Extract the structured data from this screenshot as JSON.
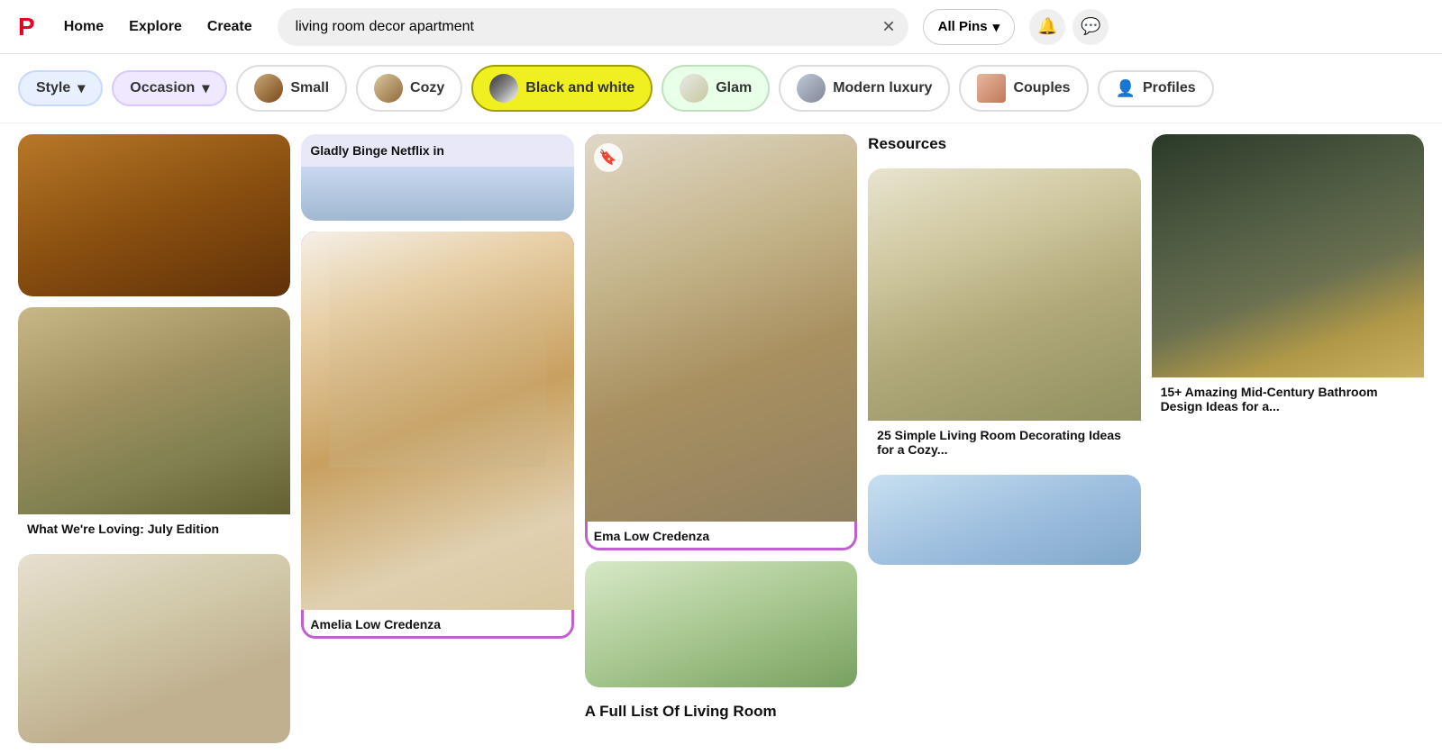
{
  "header": {
    "nav": [
      {
        "label": "Home",
        "id": "home"
      },
      {
        "label": "Explore",
        "id": "explore"
      },
      {
        "label": "Create",
        "id": "create"
      }
    ],
    "search": {
      "value": "living room decor apartment",
      "placeholder": "Search"
    },
    "allPins": "All Pins",
    "notificationIcon": "🔔",
    "messageIcon": "💬"
  },
  "filters": [
    {
      "label": "Style",
      "type": "dropdown",
      "style": "style"
    },
    {
      "label": "Occasion",
      "type": "dropdown",
      "style": "occasion"
    },
    {
      "label": "Small",
      "type": "image",
      "style": "small"
    },
    {
      "label": "Cozy",
      "type": "image",
      "style": "cozy"
    },
    {
      "label": "Black and white",
      "type": "image",
      "style": "bw",
      "active": true
    },
    {
      "label": "Glam",
      "type": "image",
      "style": "glam"
    },
    {
      "label": "Modern luxury",
      "type": "image",
      "style": "modern"
    },
    {
      "label": "Couples",
      "type": "image",
      "style": "couples"
    },
    {
      "label": "Profiles",
      "type": "icon",
      "style": "profiles"
    }
  ],
  "pins": [
    {
      "col": 1,
      "cards": [
        {
          "label": "",
          "imgClass": "col1-card1",
          "hasLabel": false
        },
        {
          "label": "What We're Loving: July Edition",
          "imgClass": "col1-card2",
          "hasLabel": true
        },
        {
          "label": "",
          "imgClass": "col1-card3",
          "hasLabel": false
        }
      ]
    },
    {
      "col": 2,
      "cards": [
        {
          "label": "Gladly Binge Netflix in",
          "imgClass": "img-binge",
          "hasLabel": true,
          "topLabel": true
        },
        {
          "label": "Amelia Low Credenza",
          "imgClass": "img-living3",
          "hasLabel": true,
          "highlighted": true
        }
      ]
    },
    {
      "col": 3,
      "cards": [
        {
          "label": "Ema Low Credenza",
          "imgClass": "img-living4",
          "hasLabel": true,
          "highlighted": true,
          "hasBookmark": true
        }
      ]
    },
    {
      "col": 4,
      "cards": [
        {
          "label": "",
          "imgClass": "img-full-list",
          "hasLabel": false
        },
        {
          "label": "A Full List Of Living Room Resources",
          "imgClass": "",
          "hasLabel": true,
          "textOnly": true
        },
        {
          "label": "25 Simple Living Room Decorating Ideas for a Cozy...",
          "imgClass": "img-living5",
          "hasLabel": true
        }
      ]
    },
    {
      "col": 5,
      "cards": [
        {
          "label": "",
          "imgClass": "img-living6",
          "hasLabel": false
        },
        {
          "label": "15+ Amazing Mid-Century Bathroom Design Ideas for a...",
          "imgClass": "img-mid-century",
          "hasLabel": true
        }
      ]
    }
  ],
  "colors": {
    "highlight": "#c060d0",
    "activeFilter": "#f0f020",
    "brand": "#e60023"
  }
}
